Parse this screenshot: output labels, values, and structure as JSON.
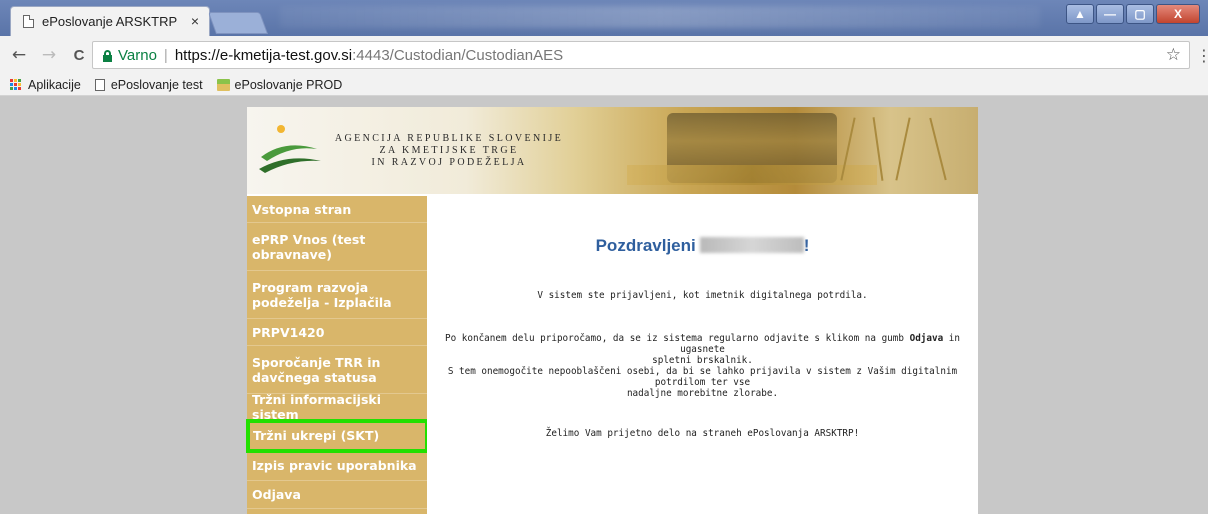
{
  "browser": {
    "tab_title": "ePoslovanje ARSKTRP",
    "tab_close": "×",
    "window_controls": [
      "▲",
      "—",
      "▢",
      "X"
    ],
    "nav": {
      "back": "←",
      "forward": "→",
      "reload": "C"
    },
    "address": {
      "secure_label": "Varno",
      "separator": "|",
      "url_host": "https://e-kmetija-test.gov.si",
      "url_path": ":4443/Custodian/CustodianAES"
    },
    "star": "☆",
    "menu": "⋮",
    "bookmarks": [
      "Aplikacije",
      "ePoslovanje test",
      "ePoslovanje PROD"
    ]
  },
  "banner": {
    "org_line1": "AGENCIJA REPUBLIKE SLOVENIJE",
    "org_line2": "ZA KMETIJSKE TRGE",
    "org_line3": "IN RAZVOJ PODEŽELJA"
  },
  "sidebar": {
    "items": [
      {
        "label": "Vstopna stran"
      },
      {
        "label": "ePRP Vnos (test obravnave)"
      },
      {
        "label": "Program razvoja podeželja - Izplačila"
      },
      {
        "label": "PRPV1420"
      },
      {
        "label": "Sporočanje TRR in davčnega statusa"
      },
      {
        "label": "Tržni informacijski sistem"
      },
      {
        "label": "Tržni ukrepi (SKT)"
      },
      {
        "label": "Izpis pravic uporabnika"
      },
      {
        "label": "Odjava"
      }
    ],
    "highlighted_index": 6
  },
  "content": {
    "greeting_prefix": "Pozdravljeni",
    "greeting_suffix": "!",
    "login_msg": "V sistem ste prijavljeni, kot imetnik digitalnega potrdila.",
    "logout_msg_1": "Po končanem delu priporočamo, da se iz sistema regularno odjavite s klikom na gumb",
    "logout_bold": "Odjava",
    "logout_msg_2": "in ugasnete",
    "logout_msg_3": "spletni brskalnik.",
    "logout_msg_4": "S tem onemogočite nepooblaščeni osebi, da bi se lahko prijavila v sistem z Vašim digitalnim potrdilom ter vse",
    "logout_msg_5": "nadaljne morebitne zlorabe.",
    "farewell": "Želimo Vam prijetno delo na straneh ePoslovanja ARSKTRP!"
  },
  "colors": {
    "sidebar_bg": "#d9b66a",
    "highlight_outline": "#22e000",
    "greeting": "#2f5f9e",
    "secure_green": "#0b8043"
  }
}
